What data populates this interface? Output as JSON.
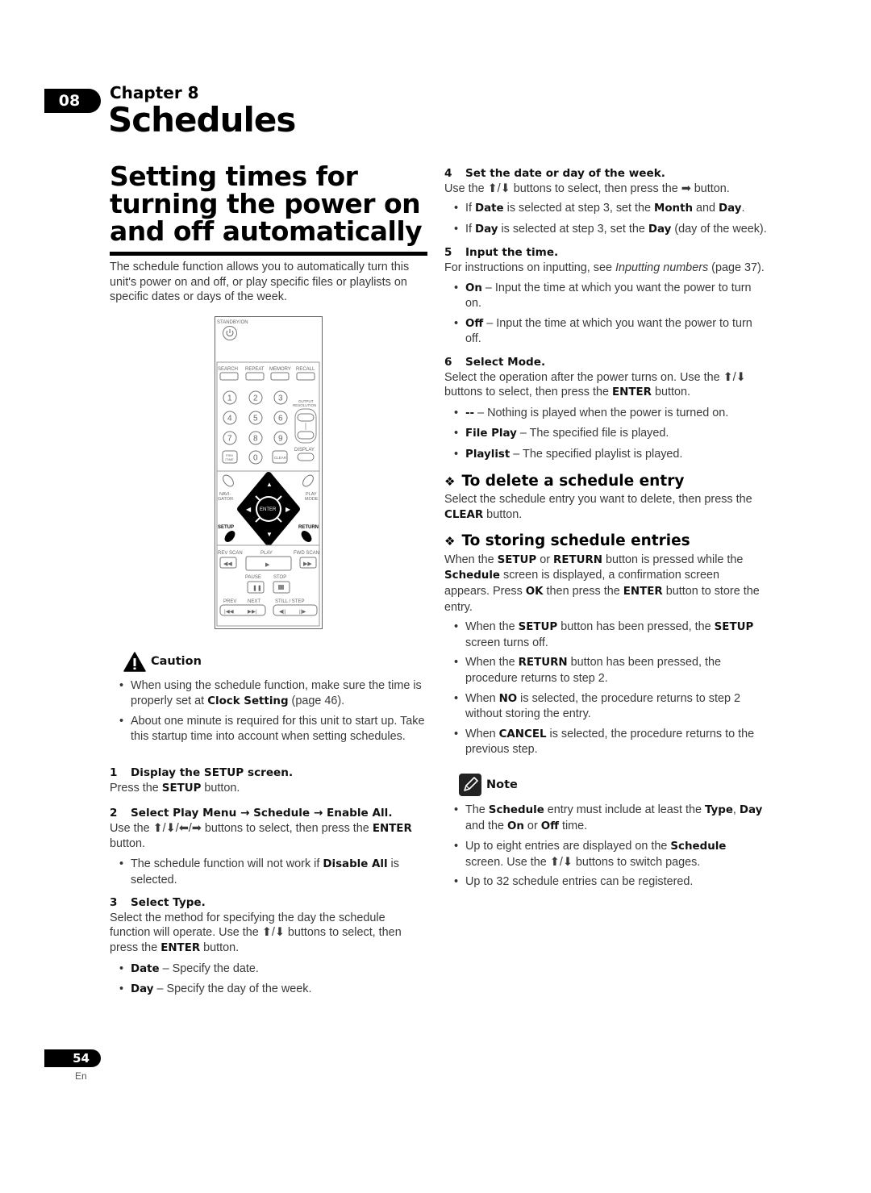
{
  "header": {
    "chapter_tab": "08",
    "chapter_label": "Chapter 8",
    "chapter_title": "Schedules"
  },
  "section_title": "Setting times for turning the power on and off automatically",
  "intro": "The schedule function allows you to automatically turn this unit's power on and off, or play specific files or playlists on specific dates or days of the week.",
  "remote": {
    "labels": {
      "standby": "STANDBY/ON",
      "search": "SEARCH",
      "repeat": "REPEAT",
      "memory": "MEMORY",
      "recall": "RECALL",
      "output": "OUTPUT",
      "resolution": "RESOLUTION",
      "display": "DISPLAY",
      "frm": "FRM",
      "time": "/TIME",
      "clear": "CLEAR",
      "navi": "NAVI-",
      "gator": "GATOR",
      "play_top": "PLAY",
      "mode": "MODE",
      "enter": "ENTER",
      "setup": "SETUP",
      "return": "RETURN",
      "rev_scan": "REV SCAN",
      "play": "PLAY",
      "fwd_scan": "FWD SCAN",
      "pause": "PAUSE",
      "stop": "STOP",
      "prev": "PREV",
      "next": "NEXT",
      "still_step": "STILL / STEP"
    },
    "digits": [
      "1",
      "2",
      "3",
      "4",
      "5",
      "6",
      "7",
      "8",
      "9",
      "0"
    ]
  },
  "caution": {
    "title": "Caution",
    "items": [
      {
        "pre": "When using the schedule function, make sure the time is properly set at ",
        "bold": "Clock Setting",
        "post": " (page 46)."
      },
      {
        "pre": "About one minute is required for this unit to start up. Take this startup time into account when setting schedules.",
        "bold": "",
        "post": ""
      }
    ]
  },
  "steps": {
    "s1": {
      "num": "1",
      "title": "Display the SETUP screen.",
      "pre": "Press the ",
      "bold": "SETUP",
      "post": " button."
    },
    "s2": {
      "num": "2",
      "title": "Select Play Menu → Schedule → Enable All.",
      "pre": "Use the ⬆/⬇/⬅/➡ buttons to select, then press the ",
      "bold": "ENTER",
      "post": " button.",
      "bullet_pre": "The schedule function will not work if ",
      "bullet_bold": "Disable All",
      "bullet_post": " is selected."
    },
    "s3": {
      "num": "3",
      "title": "Select Type.",
      "pre": "Select the method for specifying the day the schedule function will operate. Use the ⬆/⬇ buttons to select, then press the ",
      "bold": "ENTER",
      "post": " button.",
      "bullets": [
        {
          "bold": "Date",
          "text": " – Specify the date."
        },
        {
          "bold": "Day",
          "text": " – Specify the day of the week."
        }
      ]
    },
    "s4": {
      "num": "4",
      "title": "Set the date or day of the week.",
      "body": "Use the ⬆/⬇ buttons to select, then press the ➡ button.",
      "b1": {
        "a": "If ",
        "b": "Date",
        "c": " is selected at step 3, set the ",
        "d": "Month",
        "e": " and ",
        "f": "Day",
        "g": "."
      },
      "b2": {
        "a": "If ",
        "b": "Day",
        "c": " is selected at step 3, set the ",
        "d": "Day",
        "e": " (day of the week)."
      }
    },
    "s5": {
      "num": "5",
      "title": "Input the time.",
      "pre": "For instructions on inputting, see ",
      "italic": "Inputting numbers",
      "post": " (page 37).",
      "bullets": [
        {
          "bold": "On",
          "text": " – Input the time at which you want the power to turn on."
        },
        {
          "bold": "Off",
          "text": " – Input the time at which you want the power to turn off."
        }
      ]
    },
    "s6": {
      "num": "6",
      "title": "Select Mode.",
      "pre": "Select the operation after the power turns on. Use the ⬆/⬇ buttons to select, then press the ",
      "bold": "ENTER",
      "post": " button.",
      "bullets": [
        {
          "bold": "--",
          "text": " – Nothing is played when the power is turned on."
        },
        {
          "bold": "File Play",
          "text": " – The specified file is played."
        },
        {
          "bold": "Playlist",
          "text": " – The specified playlist is played."
        }
      ]
    }
  },
  "delete_section": {
    "title": "To delete a schedule entry",
    "pre": "Select the schedule entry you want to delete, then press the ",
    "bold": "CLEAR",
    "post": " button."
  },
  "store_section": {
    "title": "To storing schedule entries",
    "p": {
      "a": "When the ",
      "b": "SETUP",
      "c": " or ",
      "d": "RETURN",
      "e": " button is pressed while the ",
      "f": "Schedule",
      "g": " screen is displayed, a confirmation screen appears. Press ",
      "h": "OK",
      "i": " then press the ",
      "j": "ENTER",
      "k": " button to store the entry."
    },
    "bullets": [
      {
        "a": "When the ",
        "b": "SETUP",
        "c": " button has been pressed, the ",
        "d": "SETUP",
        "e": " screen turns off."
      },
      {
        "a": "When the ",
        "b": "RETURN",
        "c": " button has been pressed, the procedure returns to step 2.",
        "d": "",
        "e": ""
      },
      {
        "a": "When ",
        "b": "NO",
        "c": " is selected, the procedure returns to step 2 without storing the entry.",
        "d": "",
        "e": ""
      },
      {
        "a": "When ",
        "b": "CANCEL",
        "c": " is selected, the procedure returns to the previous step.",
        "d": "",
        "e": ""
      }
    ]
  },
  "note": {
    "title": "Note",
    "b1": {
      "a": "The ",
      "b": "Schedule",
      "c": " entry must include at least the ",
      "d": "Type",
      "e": ", ",
      "f": "Day",
      "g": " and the ",
      "h": "On",
      "i": " or ",
      "j": "Off",
      "k": " time."
    },
    "b2": {
      "a": "Up to eight entries are displayed on the ",
      "b": "Schedule",
      "c": " screen. Use the ⬆/⬇ buttons to switch pages."
    },
    "b3": "Up to 32 schedule entries can be registered."
  },
  "footer": {
    "page": "54",
    "lang": "En"
  }
}
